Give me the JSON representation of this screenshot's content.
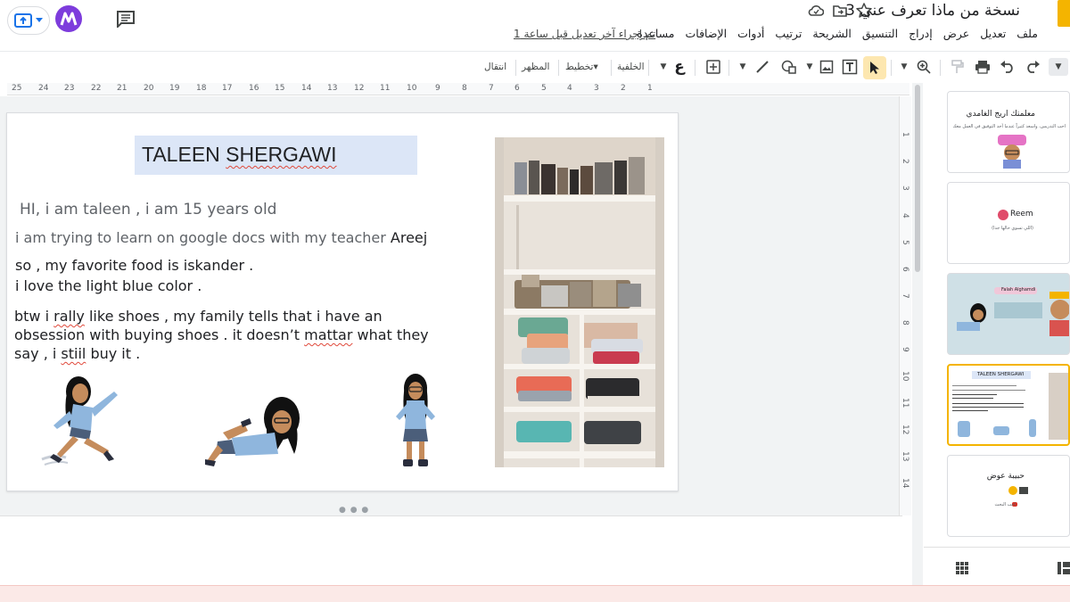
{
  "app": {
    "doc_title": "نسخة من ماذا تعرف عني 3",
    "last_edit": "تم إجراء آخر تعديل قبل ساعة 1",
    "menu": [
      "ملف",
      "تعديل",
      "عرض",
      "إدراج",
      "التنسيق",
      "الشريحة",
      "ترتيب",
      "أدوات",
      "الإضافات",
      "مساعدة"
    ]
  },
  "toolbar": {
    "transition": "انتقال",
    "theme": "المظهر",
    "layout": "تخطيط",
    "background": "الخلفية",
    "input_tool": "ع"
  },
  "ruler": {
    "h_ticks": [
      "25",
      "24",
      "23",
      "22",
      "21",
      "20",
      "19",
      "18",
      "17",
      "16",
      "15",
      "14",
      "13",
      "12",
      "11",
      "10",
      "9",
      "8",
      "7",
      "6",
      "5",
      "4",
      "3",
      "2",
      "1"
    ],
    "v_ticks": [
      "1",
      "2",
      "3",
      "4",
      "5",
      "6",
      "7",
      "8",
      "9",
      "10",
      "11",
      "12",
      "13",
      "14"
    ]
  },
  "slide": {
    "title_part1": "TALEEN ",
    "title_part2": "SHERGAWI",
    "line1": "HI, i am taleen , i am 15 years old",
    "line2a": "i am trying to learn on google docs with my teacher ",
    "line2b": "Areej",
    "line3": "so , my favorite food is iskander .",
    "line4": "i love the light blue color .",
    "line5a": "btw i ",
    "line5b": "rally",
    "line5c": " like shoes , my family tells that i have an",
    "line6a": "obsession with buying shoes . it doesn’t  ",
    "line6b": "mattar",
    "line6c": " what they",
    "line7a": "say , i ",
    "line7b": "stiil",
    "line7c": " buy it ."
  },
  "filmstrip": {
    "slides": [
      {
        "title": "معلمتك اريج الغامدي",
        "sub": "احب التدريس، واسعد كثيراً عندما أجد التوفيق في العمل معك"
      },
      {
        "title": "Reem",
        "sub": "(اللي تسوي حالها جدا)"
      },
      {
        "title": "Falah Alghamdi",
        "sub": ""
      },
      {
        "title": "TALEEN SHERGAWI",
        "sub": ""
      },
      {
        "title": "حبيبة عوض",
        "sub": "احب البحث"
      }
    ]
  },
  "colors": {
    "accent_selected": "#f4b400",
    "title_box": "#dce6f7",
    "spell_error": "#e0493b",
    "status_bar": "#fbe9e7"
  }
}
